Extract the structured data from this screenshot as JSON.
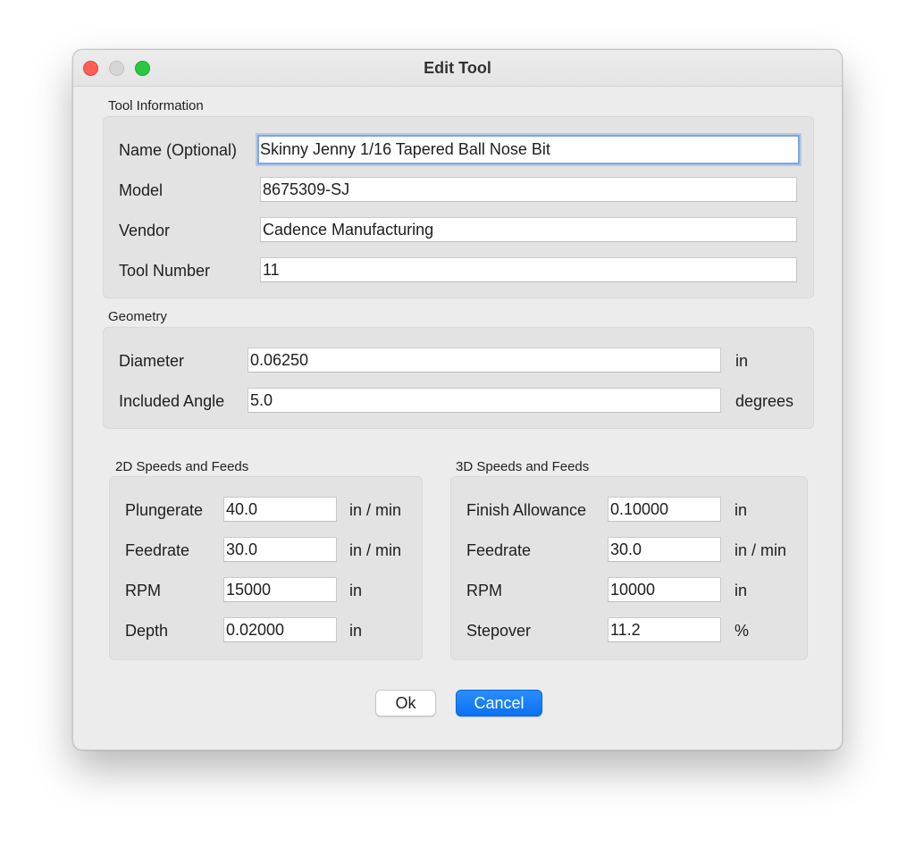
{
  "window": {
    "title": "Edit Tool"
  },
  "tool_info": {
    "section_label": "Tool Information",
    "name": {
      "label": "Name (Optional)",
      "value": "Skinny Jenny 1/16 Tapered Ball Nose Bit"
    },
    "model": {
      "label": "Model",
      "value": "8675309-SJ"
    },
    "vendor": {
      "label": "Vendor",
      "value": "Cadence Manufacturing"
    },
    "tool_number": {
      "label": "Tool Number",
      "value": "11"
    }
  },
  "geometry": {
    "section_label": "Geometry",
    "diameter": {
      "label": "Diameter",
      "value": "0.06250",
      "unit": "in"
    },
    "included_angle": {
      "label": "Included Angle",
      "value": "5.0",
      "unit": "degrees"
    }
  },
  "speeds_2d": {
    "section_label": "2D Speeds and Feeds",
    "plungerate": {
      "label": "Plungerate",
      "value": "40.0",
      "unit": "in / min"
    },
    "feedrate": {
      "label": "Feedrate",
      "value": "30.0",
      "unit": "in / min"
    },
    "rpm": {
      "label": "RPM",
      "value": "15000",
      "unit": "in"
    },
    "depth": {
      "label": "Depth",
      "value": "0.02000",
      "unit": "in"
    }
  },
  "speeds_3d": {
    "section_label": "3D Speeds and Feeds",
    "finish_allowance": {
      "label": "Finish Allowance",
      "value": "0.10000",
      "unit": "in"
    },
    "feedrate": {
      "label": "Feedrate",
      "value": "30.0",
      "unit": "in / min"
    },
    "rpm": {
      "label": "RPM",
      "value": "10000",
      "unit": "in"
    },
    "stepover": {
      "label": "Stepover",
      "value": "11.2",
      "unit": "%"
    }
  },
  "buttons": {
    "ok": "Ok",
    "cancel": "Cancel"
  }
}
